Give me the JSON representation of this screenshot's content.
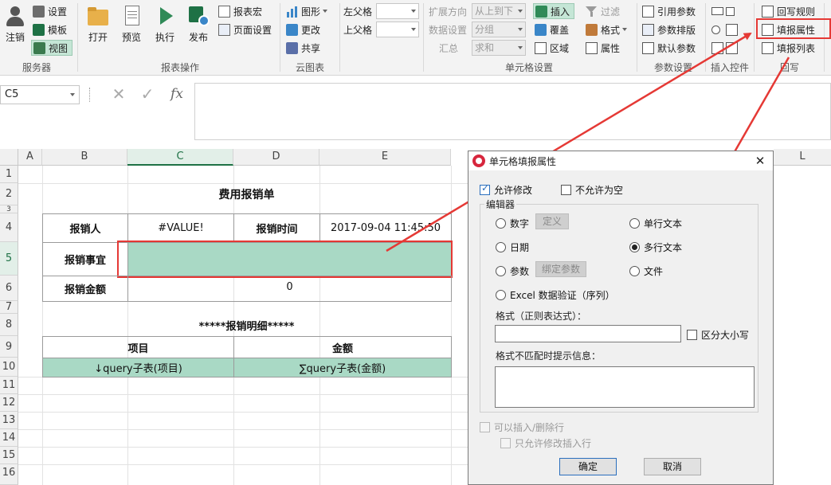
{
  "ribbon": {
    "server": {
      "logout": "注销",
      "settings": "设置",
      "template": "模板",
      "view": "视图",
      "group": "服务器"
    },
    "report_ops": {
      "open": "打开",
      "preview": "预览",
      "execute": "执行",
      "publish": "发布",
      "report_macro": "报表宏",
      "page_setup": "页面设置",
      "group": "报表操作"
    },
    "cloud": {
      "graph": "图形",
      "update": "更改",
      "share": "共享",
      "group": "云图表"
    },
    "parent": {
      "left": "左父格",
      "top": "上父格"
    },
    "cell_settings": {
      "expand_dir": "扩展方向",
      "expand_val": "从上到下",
      "data_setting": "数据设置",
      "data_val": "分组",
      "summary": "汇总",
      "summary_val": "求和",
      "insert": "插入",
      "cover": "覆盖",
      "area": "区域",
      "filter": "过滤",
      "format": "格式",
      "property": "属性",
      "group": "单元格设置"
    },
    "param": {
      "ref_param": "引用参数",
      "param_layout": "参数排版",
      "default_param": "默认参数",
      "group": "参数设置"
    },
    "insert_ctrl": {
      "group": "插入控件"
    },
    "writeback": {
      "rules": "回写规则",
      "fill_property": "填报属性",
      "fill_list": "填报列表",
      "group": "回写"
    }
  },
  "formula": {
    "namebox": "C5",
    "fx": "fx"
  },
  "sheet": {
    "cols": [
      "A",
      "B",
      "C",
      "D",
      "E",
      "L"
    ],
    "rows": [
      "1",
      "2",
      "3",
      "4",
      "5",
      "6",
      "7",
      "8",
      "9",
      "10",
      "11",
      "12",
      "13",
      "14",
      "15",
      "16"
    ],
    "title": "费用报销单",
    "r4": [
      "报销人",
      "#VALUE!",
      "报销时间",
      "2017-09-04 11:45:50"
    ],
    "r5": [
      "报销事宜"
    ],
    "r6": [
      "报销金额",
      "0"
    ],
    "r8": "*****报销明细*****",
    "r9": [
      "项目",
      "金额"
    ],
    "r10": [
      "↓query子表(项目)",
      "∑query子表(金额)"
    ]
  },
  "dialog": {
    "title": "单元格填报属性",
    "allow_edit": "允许修改",
    "not_empty": "不允许为空",
    "editor": "编辑器",
    "number": "数字",
    "define": "定义",
    "single_text": "单行文本",
    "date": "日期",
    "multi_text": "多行文本",
    "param": "参数",
    "bind_param": "绑定参数",
    "file": "文件",
    "excel_validation": "Excel 数据验证（序列）",
    "format_label": "格式（正则表达式）：",
    "case_sensitive": "区分大小写",
    "mismatch_label": "格式不匹配时提示信息：",
    "insert_delete": "可以插入/删除行",
    "only_edit_insert": "只允许修改插入行",
    "ok": "确定",
    "cancel": "取消",
    "close": "✕"
  },
  "colors": {
    "accent": "#a9d9c5",
    "highlight_red": "#e53935"
  }
}
